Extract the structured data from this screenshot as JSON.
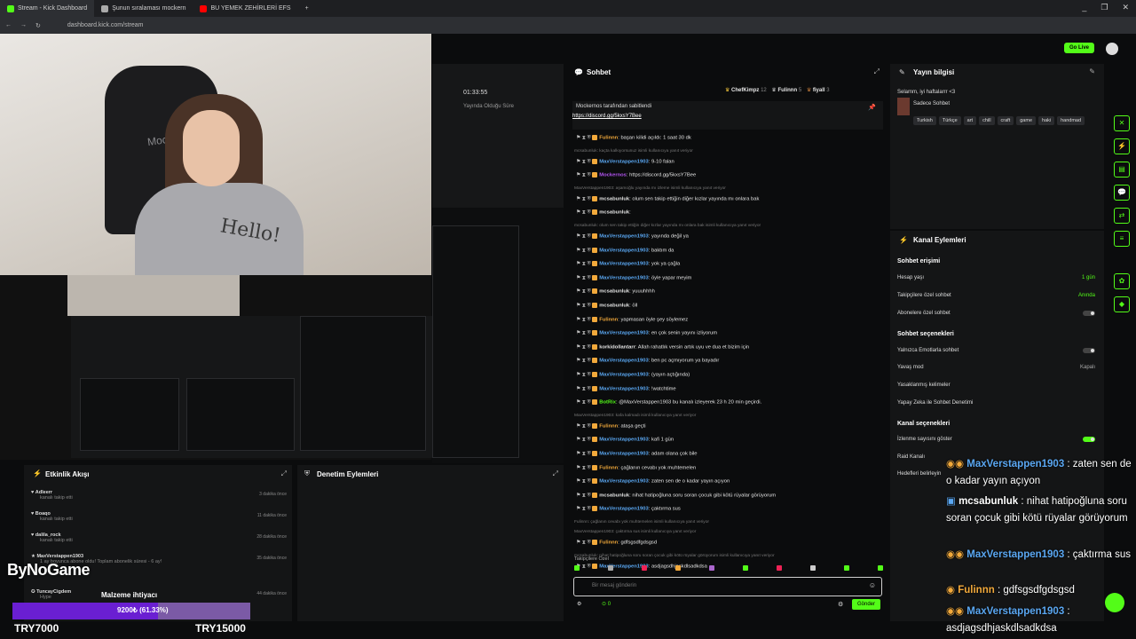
{
  "browser": {
    "tabs": [
      {
        "label": "Stream - Kick Dashboard",
        "color": "#53fc18"
      },
      {
        "label": "Şunun sıralaması mockern",
        "color": "#aaaaaa"
      },
      {
        "label": "BU YEMEK ZEHİRLERİ EFS",
        "color": "#ff0000"
      }
    ],
    "url": "dashboard.kick.com/stream",
    "window_controls": [
      "_",
      "❐",
      "✕"
    ]
  },
  "toolbar": {
    "go_live": "Go Live"
  },
  "scene": {
    "chair_text": "Mockern",
    "shirt_text": "Hello!",
    "timer": "01:33:55",
    "timer_label": "Yayında Olduğu Süre"
  },
  "overlay": {
    "logo": "ByNoGame",
    "goal_title": "Malzeme ihtiyacı",
    "goal_progress_text": "9200₺ (61.33%)",
    "goal_progress": 0.6133,
    "goal_min": "TRY7000",
    "goal_max": "TRY15000"
  },
  "activity": {
    "title": "Etkinlik Akışı",
    "items": [
      {
        "name": "Adleerr",
        "sub": "kanalı takip etti",
        "time": "3 dakika önce"
      },
      {
        "name": "Boaqo",
        "sub": "kanalı takip etti",
        "time": "11 dakika önce"
      },
      {
        "name": "dalila_rock",
        "sub": "kanalı takip etti",
        "time": "28 dakika önce"
      },
      {
        "name": "MaxVerstappen1903",
        "sub": "1 ay boyunca abone oldu! Toplam abonelik süresi - 6 ay!",
        "time": "35 dakika önce"
      },
      {
        "name": "TuncayCigdem",
        "sub": "Hype",
        "time": "44 dakika önce"
      }
    ]
  },
  "moderation": {
    "title": "Denetim Eylemleri"
  },
  "chat": {
    "title": "Sohbet",
    "top_users": [
      {
        "name": "ChefKimpz",
        "count": "12"
      },
      {
        "name": "Fulinnn",
        "count": "5"
      },
      {
        "name": "fiyall",
        "count": "3"
      }
    ],
    "pinned_by": "Mockernos tarafından sabitlendi",
    "pinned_link": "https://discord.gg/5kxsY7Bee",
    "lines": [
      {
        "type": "msg",
        "user": "Fulinnn",
        "color": "#f2a93b",
        "text": "başarı kilidi açıldı: 1 saat 30 dk"
      },
      {
        "type": "reply",
        "text": "mcsabunluk: kaçta kalkıyorsunuz isimli kullanıcıya yanıt veriyor"
      },
      {
        "type": "msg",
        "user": "MaxVerstappen1903",
        "color": "#5aa7f2",
        "text": "9-10 falan"
      },
      {
        "type": "msg",
        "user": "Mockernos",
        "color": "#b455f2",
        "text": "https://discord.gg/5kxsY7Bee"
      },
      {
        "type": "reply",
        "text": "MaxVerstappen1903: aşamoğlu yayında mı izleme isimli kullanıcıya yanıt veriyor"
      },
      {
        "type": "msg",
        "user": "mcsabunluk",
        "color": "#e6e6e6",
        "text": "olum sen takip ettiğin diğer kızlar yayında mı onlara bak"
      },
      {
        "type": "msg",
        "user": "mcsabunluk",
        "color": "#e6e6e6",
        "text": ""
      },
      {
        "type": "reply",
        "text": "mcsabunluk: olum sen takip ettiğin diğer kızlar yayında mı onlara bak isimli kullanıcıya yanıt veriyor"
      },
      {
        "type": "msg",
        "user": "MaxVerstappen1903",
        "color": "#5aa7f2",
        "text": "yayında değil ya"
      },
      {
        "type": "msg",
        "user": "MaxVerstappen1903",
        "color": "#5aa7f2",
        "text": "baktım da"
      },
      {
        "type": "msg",
        "user": "MaxVerstappen1903",
        "color": "#5aa7f2",
        "text": "yok ya çağla"
      },
      {
        "type": "msg",
        "user": "MaxVerstappen1903",
        "color": "#5aa7f2",
        "text": "öyle yapar meyim"
      },
      {
        "type": "msg",
        "user": "mcsabunluk",
        "color": "#e6e6e6",
        "text": "yuuuhhhh"
      },
      {
        "type": "msg",
        "user": "mcsabunluk",
        "color": "#e6e6e6",
        "text": "öll"
      },
      {
        "type": "msg",
        "user": "Fulinnn",
        "color": "#f2a93b",
        "text": "yapmasan öyle şey söylemez"
      },
      {
        "type": "msg",
        "user": "MaxVerstappen1903",
        "color": "#5aa7f2",
        "text": "en çok senin yayını izliyorum"
      },
      {
        "type": "msg",
        "user": "korkidollantarr",
        "color": "#e6e6e6",
        "text": "Allah rahatlık versin artık uyu ve dua et bizim için"
      },
      {
        "type": "msg",
        "user": "MaxVerstappen1903",
        "color": "#5aa7f2",
        "text": "ben pc açmıyorum ya bayadır"
      },
      {
        "type": "msg",
        "user": "MaxVerstappen1903",
        "color": "#5aa7f2",
        "text": "(yayın açtığında)"
      },
      {
        "type": "msg",
        "user": "MaxVerstappen1903",
        "color": "#5aa7f2",
        "text": "!watchtime"
      },
      {
        "type": "msg",
        "user": "BotRix",
        "color": "#53fc18",
        "text": "@MaxVerstappen1903 bu kanalı izleyerek 23 h 20 min geçirdi."
      },
      {
        "type": "reply",
        "text": "MaxVerstappen1903: kafa kalmadı isimli kullanıcıya yanıt veriyor"
      },
      {
        "type": "msg",
        "user": "Fulinnn",
        "color": "#f2a93b",
        "text": "ataşa geçti"
      },
      {
        "type": "msg",
        "user": "MaxVerstappen1903",
        "color": "#5aa7f2",
        "text": "kafi 1 gün"
      },
      {
        "type": "msg",
        "user": "MaxVerstappen1903",
        "color": "#5aa7f2",
        "text": "adam olana çok bile"
      },
      {
        "type": "msg",
        "user": "Fulinnn",
        "color": "#f2a93b",
        "text": "çağlanın cevabı yok muhtemelen"
      },
      {
        "type": "msg",
        "user": "MaxVerstappen1903",
        "color": "#5aa7f2",
        "text": "zaten sen de o kadar yayın açıyon"
      },
      {
        "type": "msg",
        "user": "mcsabunluk",
        "color": "#e6e6e6",
        "text": "nihat hatipoğluna soru soran çocuk gibi kötü rüyalar görüyorum"
      },
      {
        "type": "msg",
        "user": "MaxVerstappen1903",
        "color": "#5aa7f2",
        "text": "çaktırma sus"
      },
      {
        "type": "reply",
        "text": "Fulinnn: çağlanın cevabı yok muhtemelen isimli kullanıcıya yanıt veriyor"
      },
      {
        "type": "reply",
        "text": "MaxVerstappen1903: çaktırma sus isimli kullanıcıya yanıt veriyor"
      },
      {
        "type": "msg",
        "user": "Fulinnn",
        "color": "#f2a93b",
        "text": "gdfsgsdfgdsgsd"
      },
      {
        "type": "reply",
        "text": "mcsabunluk: nihat hatipoğluna soru soran çocuk gibi kötü rüyalar görüyorum isimli kullanıcıya yanıt veriyor"
      },
      {
        "type": "msg",
        "user": "MaxVerstappen1903",
        "color": "#5aa7f2",
        "text": "asdjagsdhjaskdlsadkdsa"
      }
    ],
    "followers_only": "Takipçilere Özel",
    "input_placeholder": "Bir mesaj gönderin",
    "points": "0",
    "send": "Gönder"
  },
  "stream_info": {
    "title": "Yayın bilgisi",
    "stream_title": "Selamm, iyi haftalarrr <3",
    "category": "Sadece Sohbet",
    "tags": [
      "Turkish",
      "Türkçe",
      "art",
      "chill",
      "craft",
      "game",
      "haki",
      "handmad"
    ]
  },
  "channel_actions": {
    "title": "Kanal Eylemleri",
    "access_section": "Sohbet erişimi",
    "account_age_label": "Hesap yaşı",
    "account_age_value": "1 gün",
    "followers_only_label": "Takipçilere özel sohbet",
    "followers_only_value": "Anında",
    "subs_only_label": "Abonelere özel sohbet",
    "options_section": "Sohbet seçenekleri",
    "emotes_only_label": "Yalnızca Emotlarla sohbet",
    "slow_mode_label": "Yavaş mod",
    "slow_mode_value": "Kapalı",
    "banned_words_label": "Yasaklanmış kelimeler",
    "ai_moderation_label": "Yapay Zeka ile Sohbet Denetimi",
    "channel_section": "Kanal seçenekleri",
    "viewer_count_label": "İzlenme sayısını göster",
    "raid_label": "Raid Kanalı",
    "host_label": "Hedefleri belirleyin"
  },
  "big_chat": [
    {
      "user": "MaxVerstappen1903",
      "text": " : zaten sen de o kadar yayın açıyon",
      "color": "#5aa7f2"
    },
    {
      "user": "mcsabunluk",
      "text": " : nihat hatipoğluna soru soran çocuk gibi kötü rüyalar görüyorum",
      "color": "#ffffff"
    },
    {
      "user": "MaxVerstappen1903",
      "text": " : çaktırma sus",
      "color": "#5aa7f2"
    },
    {
      "user": "Fulinnn",
      "text": " : gdfsgsdfgdsgsd",
      "color": "#f2a93b"
    },
    {
      "user": "MaxVerstappen1903",
      "text": " : asdjagsdhjaskdlsadkdsa",
      "color": "#5aa7f2"
    }
  ]
}
